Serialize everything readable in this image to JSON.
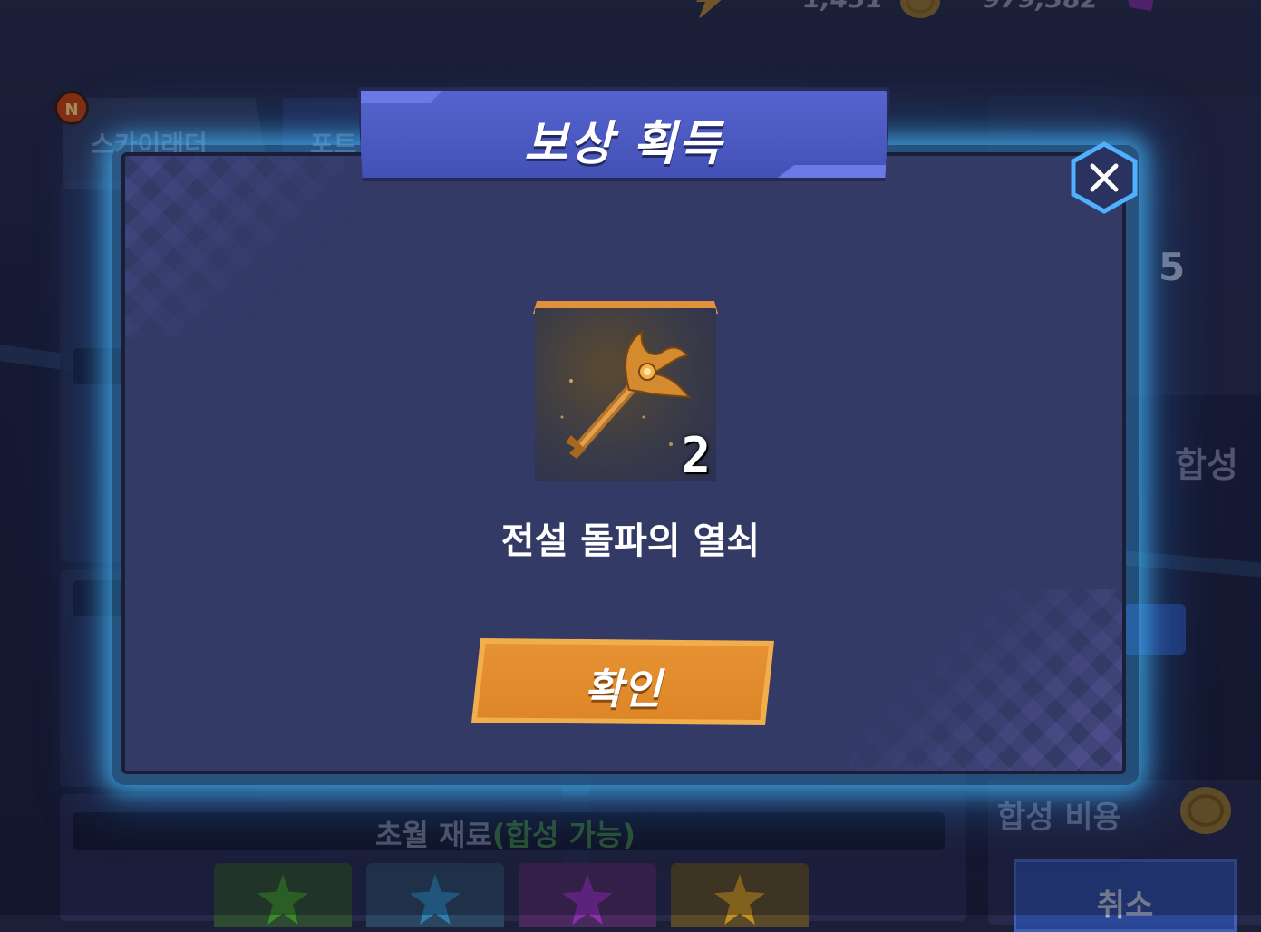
{
  "background": {
    "currencies": [
      {
        "icon": "lightning-icon",
        "value": "1,431"
      },
      {
        "icon": "gold-coin-icon",
        "value": "979,382"
      },
      {
        "icon": "gem-icon",
        "value": ""
      }
    ],
    "tabs": [
      {
        "label": "스카이래더"
      },
      {
        "label": "포트"
      }
    ],
    "badge": "N",
    "level_number": "5",
    "synthesis_label": "합성",
    "synthesis_cost_label": "합성 비용",
    "materials_label": "초월 재료",
    "materials_available": "(합성 가능)",
    "cancel_label": "취소",
    "crystal_colors": [
      "#3c8a2a",
      "#2f7fb0",
      "#8a2fb0",
      "#c09020"
    ]
  },
  "modal": {
    "title": "보상 획득",
    "reward": {
      "name": "전설 돌파의 열쇠",
      "count": "2",
      "icon": "legendary-key-icon"
    },
    "confirm_label": "확인",
    "close_icon": "close-icon"
  },
  "colors": {
    "modal_bg": "#333a66",
    "title_banner": "#4d5bc7",
    "confirm": "#e28c2e",
    "glow": "#46beff",
    "frame_accent": "#e2913b"
  }
}
